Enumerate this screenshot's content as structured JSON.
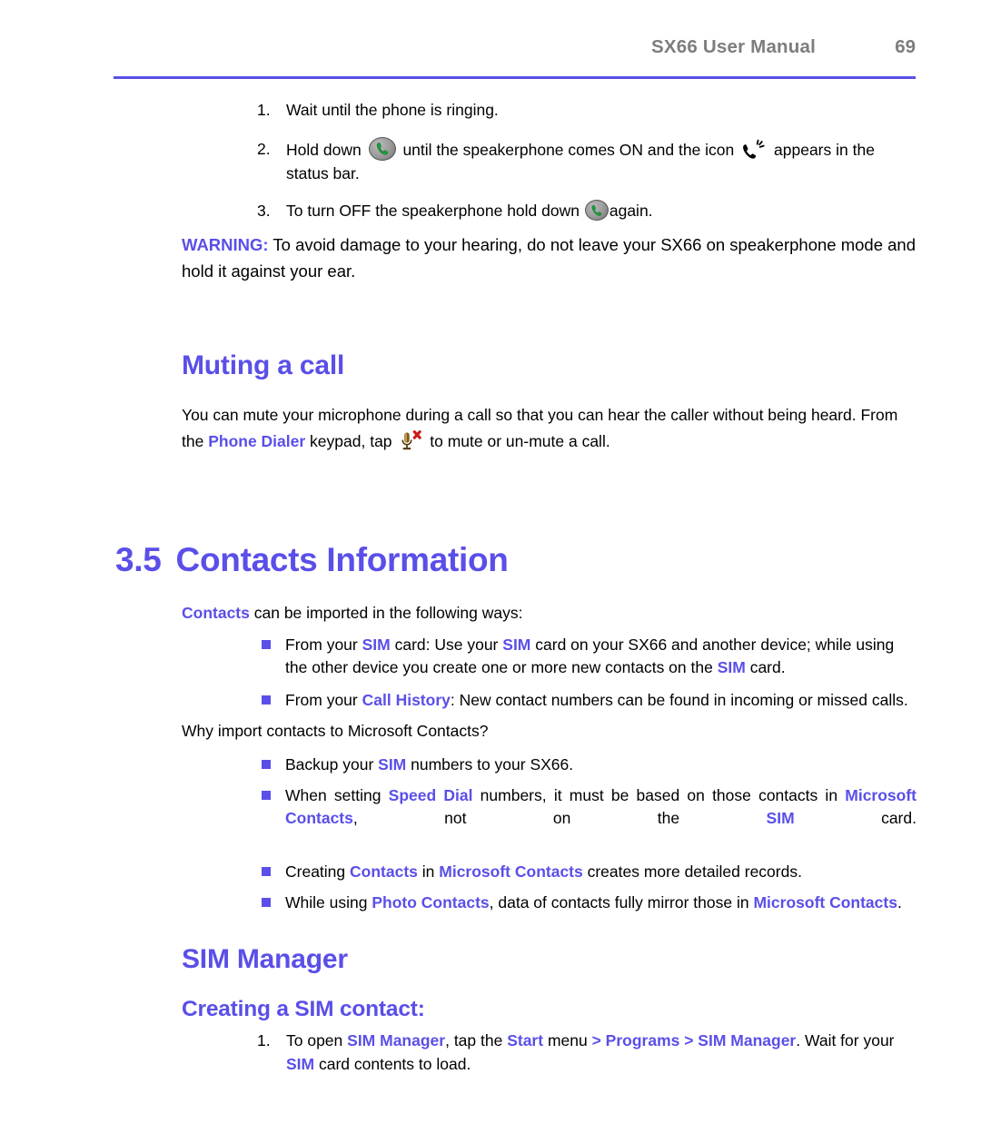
{
  "header": {
    "title": "SX66 User Manual",
    "page_number": "69",
    "rule_color": "#5a4fe8"
  },
  "colors": {
    "accent": "#5a4fe8",
    "header_gray": "#7d7d7d",
    "body_black": "#000000",
    "mute_x_red": "#cc1b1b",
    "phone_green": "#15a03a"
  },
  "speakerphone_steps": [
    {
      "number": "1.",
      "parts": [
        {
          "type": "text",
          "value": "Wait until the phone is ringing."
        }
      ]
    },
    {
      "number": "2.",
      "parts": [
        {
          "type": "text",
          "value": "Hold down "
        },
        {
          "type": "icon",
          "icon": "phone-call-button-icon"
        },
        {
          "type": "text",
          "value": " until the speakerphone comes ON and the icon "
        },
        {
          "type": "icon",
          "icon": "speakerphone-status-icon"
        },
        {
          "type": "text",
          "value": " appears in the status bar."
        }
      ]
    },
    {
      "number": "3.",
      "parts": [
        {
          "type": "text",
          "value": "To turn OFF the speakerphone hold down "
        },
        {
          "type": "icon",
          "icon": "phone-call-button-icon"
        },
        {
          "type": "text",
          "value": "again."
        }
      ]
    }
  ],
  "step1_text": "Wait until the phone is ringing.",
  "step2": {
    "before_icon": "Hold down",
    "middle": "until the speakerphone comes ON and the icon",
    "after_icon": "appears in the status bar."
  },
  "step3": {
    "before_icon": "To turn OFF the speakerphone hold down",
    "after_icon": "again."
  },
  "warning": {
    "label": "WARNING:",
    "text": "To avoid damage to your hearing, do not leave your SX66 on speakerphone mode and hold it against your ear."
  },
  "muting": {
    "heading": "Muting a call",
    "line1": "You can mute your microphone during a call so that you can hear the caller without being heard. From the ",
    "phone_dialer": "Phone Dialer",
    "line2": " keypad, tap ",
    "line3": " to mute or un-mute a call."
  },
  "contacts_section": {
    "number": "3.5",
    "title": "Contacts Information",
    "intro_bold": "Contacts",
    "intro_rest": " can be imported in the following ways:",
    "import_bullets": [
      {
        "segments": [
          {
            "text": "From your ",
            "hl": false
          },
          {
            "text": "SIM",
            "hl": true
          },
          {
            "text": " card: Use your ",
            "hl": false
          },
          {
            "text": "SIM",
            "hl": true
          },
          {
            "text": " card on your SX66 and another device; while using the other device you create one or more new contacts on the ",
            "hl": false
          },
          {
            "text": "SIM",
            "hl": true
          },
          {
            "text": " card.",
            "hl": false
          }
        ]
      },
      {
        "segments": [
          {
            "text": "From your ",
            "hl": false
          },
          {
            "text": "Call History",
            "hl": true
          },
          {
            "text": ": New contact numbers can be found in incoming or missed calls.",
            "hl": false
          }
        ]
      }
    ],
    "why_heading": "Why import contacts to Microsoft Contacts?",
    "why_bullets": [
      {
        "justify": false,
        "segments": [
          {
            "text": "Backup your ",
            "hl": false
          },
          {
            "text": "SIM",
            "hl": true
          },
          {
            "text": " numbers to your SX66.",
            "hl": false
          }
        ]
      },
      {
        "justify": true,
        "segments": [
          {
            "text": "When setting ",
            "hl": false
          },
          {
            "text": "Speed Dial",
            "hl": true
          },
          {
            "text": " numbers, it must be based on those contacts in ",
            "hl": false
          },
          {
            "text": "Microsoft Contacts",
            "hl": true
          },
          {
            "text": ", not on the ",
            "hl": false
          },
          {
            "text": "SIM",
            "hl": true
          },
          {
            "text": " card.",
            "hl": false
          }
        ]
      },
      {
        "justify": false,
        "segments": [
          {
            "text": "Creating ",
            "hl": false
          },
          {
            "text": "Contacts",
            "hl": true
          },
          {
            "text": " in ",
            "hl": false
          },
          {
            "text": "Microsoft Contacts",
            "hl": true
          },
          {
            "text": " creates more detailed records.",
            "hl": false
          }
        ]
      },
      {
        "justify": false,
        "segments": [
          {
            "text": "While using ",
            "hl": false
          },
          {
            "text": "Photo Contacts",
            "hl": true
          },
          {
            "text": ", data of contacts fully mirror those in ",
            "hl": false
          },
          {
            "text": "Microsoft Contacts",
            "hl": true
          },
          {
            "text": ".",
            "hl": false
          }
        ]
      }
    ]
  },
  "sim_manager": {
    "heading": "SIM Manager",
    "subheading": "Creating a SIM contact:",
    "step": {
      "number": "1.",
      "segments": [
        {
          "text": "To open ",
          "hl": false
        },
        {
          "text": "SIM Manager",
          "hl": true
        },
        {
          "text": ", tap the ",
          "hl": false
        },
        {
          "text": "Start",
          "hl": true
        },
        {
          "text": " menu ",
          "hl": false
        },
        {
          "text": "> Programs > SIM Manager",
          "hl": true
        },
        {
          "text": ". Wait for your ",
          "hl": false
        },
        {
          "text": "SIM",
          "hl": true
        },
        {
          "text": " card contents to load.",
          "hl": false
        }
      ]
    }
  },
  "icons": {
    "phone_call_button": "phone-call-button-icon",
    "speakerphone_status": "speakerphone-status-icon",
    "mute_microphone": "mute-microphone-icon",
    "bullet_square": "square-bullet-icon"
  }
}
